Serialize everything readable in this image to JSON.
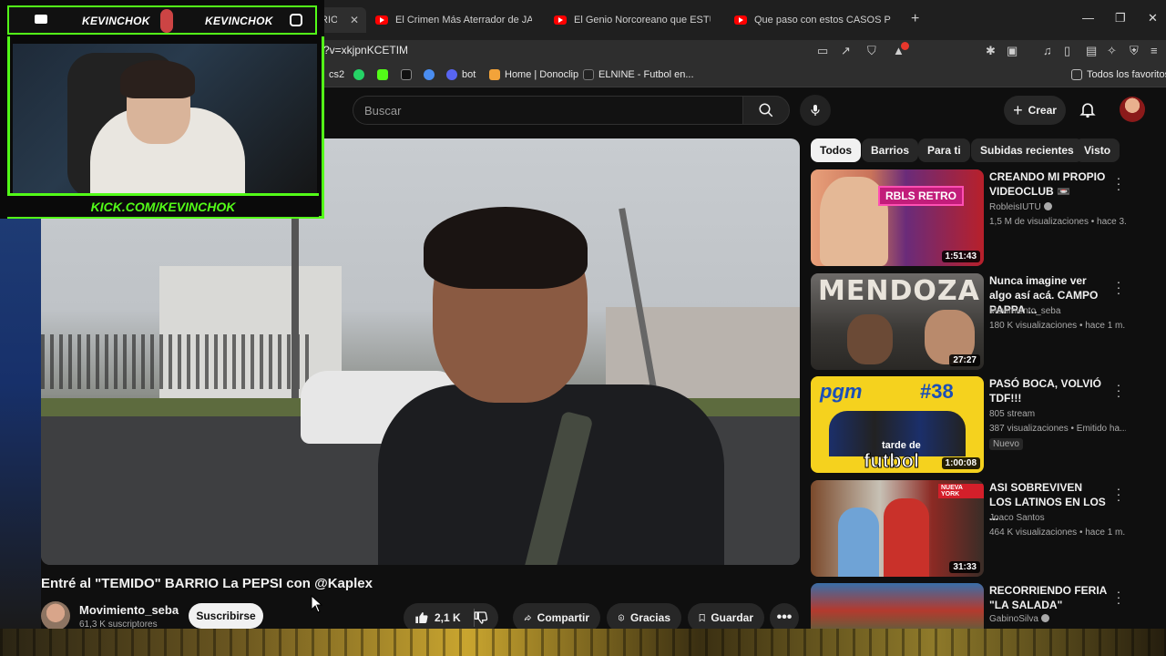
{
  "browser": {
    "tabs": [
      {
        "label": "RIO La",
        "active": true
      },
      {
        "label": "El Crimen Más Aterrador de JAPÓN |"
      },
      {
        "label": "El Genio Norcoreano que ESTUDIÓ p"
      },
      {
        "label": "Que paso con estos CASOS PERTURE"
      }
    ],
    "url": "?v=xkjpnKCETIM",
    "bookmarks": [
      "cs2",
      "bot",
      "Home | Donoclip",
      "ELNINE - Futbol en...",
      "Todos los favoritos"
    ],
    "notification_count": "1"
  },
  "overlay": {
    "streamer_name_left": "KEVINCHOK",
    "streamer_name_right": "KEVINCHOK",
    "kick_url": "KICK.COM/KEVINCHOK",
    "accent": "#53fc18"
  },
  "header": {
    "search_placeholder": "Buscar",
    "create_label": "Crear"
  },
  "video": {
    "title": "Entré al \"TEMIDO\" BARRIO La PEPSI con @Kaplex",
    "channel": "Movimiento_seba",
    "subscribers": "61,3 K suscriptores",
    "subscribe_label": "Suscribirse",
    "likes": "2,1 K",
    "share_label": "Compartir",
    "thanks_label": "Gracias",
    "save_label": "Guardar"
  },
  "chips": [
    "Todos",
    "Barrios",
    "Para ti",
    "Subidas recientes",
    "Visto"
  ],
  "recommendations": [
    {
      "title": "CREANDO MI PROPIO VIDEOCLUB 📼",
      "channel": "RobleisIUTU",
      "verified": true,
      "stats": "1,5 M de visualizaciones • hace 3...",
      "duration": "1:51:43"
    },
    {
      "title": "Nunca imagine ver algo así acá. CAMPO PAPPA ...",
      "channel": "Movimiento_seba",
      "verified": false,
      "stats": "180 K visualizaciones • hace 1 m...",
      "duration": "27:27"
    },
    {
      "title": "PASÓ BOCA, VOLVIÓ TDF!!!",
      "channel": "805 stream",
      "verified": false,
      "stats": "387 visualizaciones • Emitido ha...",
      "badge": "Nuevo",
      "duration": "1:00:08"
    },
    {
      "title": "ASI SOBREVIVEN LOS LATINOS EN LOS ...",
      "channel": "Joaco Santos",
      "verified": false,
      "stats": "464 K visualizaciones • hace 1 m...",
      "duration": "31:33"
    },
    {
      "title": "RECORRIENDO FERIA \"LA SALADA\"",
      "channel": "GabinoSilva",
      "verified": true,
      "stats": "",
      "duration": ""
    }
  ],
  "thumb_texts": {
    "rec1": "RBLS RETRO",
    "rec2": "MENDOZA",
    "rec3_a": "pgm",
    "rec3_b": "#38",
    "rec3_c": "tarde de",
    "rec3_d": "futbol",
    "rec4": "NUEVA YORK"
  }
}
